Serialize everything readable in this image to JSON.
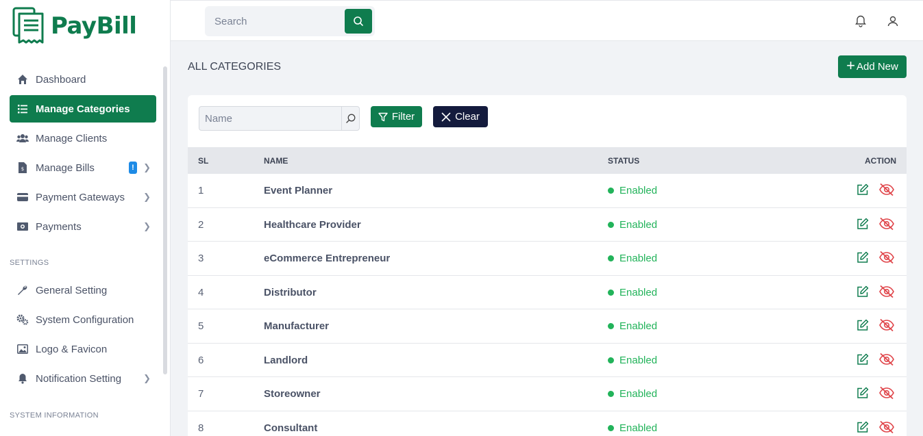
{
  "brand": {
    "name": "PayBill"
  },
  "header": {
    "search_placeholder": "Search"
  },
  "sidebar": {
    "items": [
      {
        "label": "Dashboard",
        "icon": "home-icon",
        "active": false,
        "chevron": false
      },
      {
        "label": "Manage Categories",
        "icon": "list-icon",
        "active": true,
        "chevron": false
      },
      {
        "label": "Manage Clients",
        "icon": "users-icon",
        "active": false,
        "chevron": false
      },
      {
        "label": "Manage Bills",
        "icon": "file-icon",
        "active": false,
        "chevron": true,
        "badge": "!"
      },
      {
        "label": "Payment Gateways",
        "icon": "credit-card-icon",
        "active": false,
        "chevron": true
      },
      {
        "label": "Payments",
        "icon": "money-icon",
        "active": false,
        "chevron": true
      }
    ],
    "settings_title": "SETTINGS",
    "settings_items": [
      {
        "label": "General Setting",
        "icon": "wrench-icon",
        "chevron": false
      },
      {
        "label": "System Configuration",
        "icon": "cogs-icon",
        "chevron": false
      },
      {
        "label": "Logo & Favicon",
        "icon": "image-icon",
        "chevron": false
      },
      {
        "label": "Notification Setting",
        "icon": "bell-icon",
        "chevron": true
      }
    ],
    "system_title": "SYSTEM INFORMATION"
  },
  "main": {
    "title": "ALL CATEGORIES",
    "add_label": "Add New",
    "filter": {
      "name_placeholder": "Name",
      "filter_label": "Filter",
      "clear_label": "Clear"
    },
    "table": {
      "headers": {
        "sl": "SL",
        "name": "NAME",
        "status": "STATUS",
        "action": "ACTION"
      },
      "rows": [
        {
          "sl": "1",
          "name": "Event Planner",
          "status": "Enabled"
        },
        {
          "sl": "2",
          "name": "Healthcare Provider",
          "status": "Enabled"
        },
        {
          "sl": "3",
          "name": "eCommerce Entrepreneur",
          "status": "Enabled"
        },
        {
          "sl": "4",
          "name": "Distributor",
          "status": "Enabled"
        },
        {
          "sl": "5",
          "name": "Manufacturer",
          "status": "Enabled"
        },
        {
          "sl": "6",
          "name": "Landlord",
          "status": "Enabled"
        },
        {
          "sl": "7",
          "name": "Storeowner",
          "status": "Enabled"
        },
        {
          "sl": "8",
          "name": "Consultant",
          "status": "Enabled"
        }
      ]
    }
  },
  "colors": {
    "brand": "#0f7c4e",
    "dark_button": "#141b3d",
    "status_enabled": "#22b35a",
    "danger": "#e0454a",
    "badge": "#1e8be6"
  }
}
